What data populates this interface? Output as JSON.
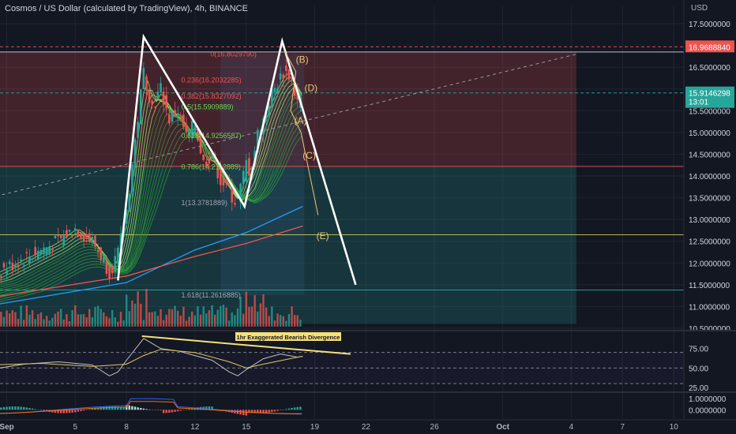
{
  "header": {
    "title": "Cosmos / US Dollar (calculated by TradingView), 4h, BINANCE",
    "currency": "USD"
  },
  "price_tags": {
    "top": "16.9688840",
    "current": "15.9146298",
    "countdown": "13:01"
  },
  "colors": {
    "background": "#131722",
    "grid": "#1f2433",
    "up": "#26a69a",
    "down": "#ef5350",
    "pattern": "#ffffff",
    "wave_labels": "#f0c674",
    "divergence": "#f5e07a",
    "fib_green": "#6bd84f",
    "fib_red": "#ef5350"
  },
  "chart_data": [
    {
      "type": "candlestick",
      "pane": "price",
      "x_axis": {
        "tick_labels": [
          "Sep",
          "5",
          "8",
          "12",
          "15",
          "19",
          "22",
          "26",
          "Oct",
          "4",
          "7",
          "10"
        ],
        "tick_days": [
          1,
          5,
          8,
          12,
          15,
          19,
          22,
          26,
          30,
          34,
          37,
          40
        ]
      },
      "y_axis": {
        "range": [
          10.5,
          17.9
        ],
        "tick_labels": [
          "17.5000000",
          "16.5000000",
          "16.0000000",
          "15.5000000",
          "15.0000000",
          "14.5000000",
          "14.0000000",
          "13.5000000",
          "13.0000000",
          "12.5000000",
          "12.0000000",
          "11.5000000",
          "11.0000000",
          "10.5000000"
        ],
        "tick_values": [
          17.5,
          16.5,
          16.0,
          15.5,
          15.0,
          14.5,
          14.0,
          13.5,
          13.0,
          12.5,
          12.0,
          11.5,
          11.0,
          10.5
        ]
      },
      "price_path": {
        "days": [
          0,
          1,
          2,
          3,
          4,
          5,
          6,
          6.6,
          7,
          7.5,
          8,
          8.5,
          9,
          9.5,
          10,
          10.5,
          11,
          11.5,
          12,
          12.5,
          13,
          13.5,
          14,
          14.3,
          14.6,
          15,
          15.3,
          15.6,
          16,
          16.4,
          16.8,
          17.2,
          17.6,
          17.9,
          18.1,
          18.3
        ],
        "closes": [
          11.7,
          11.9,
          12.1,
          12.3,
          12.5,
          12.8,
          12.5,
          12.1,
          11.8,
          12.2,
          13.2,
          14.8,
          16.4,
          15.6,
          16.0,
          15.3,
          15.5,
          14.9,
          15.2,
          14.3,
          14.5,
          13.9,
          13.7,
          13.4,
          13.6,
          14.3,
          14.0,
          14.9,
          15.3,
          15.8,
          16.1,
          16.4,
          16.3,
          15.8,
          15.6,
          15.9
        ]
      },
      "moving_averages": [
        {
          "color": "#2196f3",
          "points": [
            [
              0,
              11.02
            ],
            [
              8,
              11.55
            ],
            [
              12,
              12.3
            ],
            [
              15,
              12.7
            ],
            [
              18.3,
              13.3
            ]
          ]
        },
        {
          "color": "#ef5350",
          "points": [
            [
              0,
              11.2
            ],
            [
              8,
              11.7
            ],
            [
              12,
              12.15
            ],
            [
              15,
              12.45
            ],
            [
              18.3,
              12.85
            ]
          ]
        }
      ],
      "fibonacci": {
        "levels": [
          {
            "label": "0(16.8029790)",
            "value": 16.8
          },
          {
            "label": "0.236(16.2032285)",
            "value": 16.2
          },
          {
            "label": "0.382(15.8327092)",
            "value": 15.83
          },
          {
            "label": "0.5(15.5909889)",
            "value": 15.59
          },
          {
            "label": "0.618(14.9256587)",
            "value": 14.93
          },
          {
            "label": "0.786(14.2112889)",
            "value": 14.21
          },
          {
            "label": "1(13.3781889)",
            "value": 13.38
          },
          {
            "label": "1.618(11.2616885)",
            "value": 11.26
          }
        ]
      },
      "zones": [
        {
          "top": 16.85,
          "bottom": 14.22,
          "color": "#ef5350"
        },
        {
          "top": 14.22,
          "bottom": 10.6,
          "color": "#26a69a"
        }
      ],
      "horizontal_lines": [
        {
          "value": 16.97,
          "color": "#ef5350",
          "dashed": true
        },
        {
          "value": 16.85,
          "color": "#d1d4dc",
          "dashed": false
        },
        {
          "value": 15.91,
          "color": "#26a69a",
          "dashed": true
        },
        {
          "value": 14.22,
          "color": "#ef5350",
          "dashed": false
        },
        {
          "value": 12.65,
          "color": "#c8c85a",
          "dashed": false
        },
        {
          "value": 11.38,
          "color": "#26a69a",
          "dashed": false
        }
      ],
      "pattern": {
        "points": [
          [
            7.5,
            11.6
          ],
          [
            9.0,
            17.2
          ],
          [
            14.9,
            13.3
          ],
          [
            17.1,
            17.1
          ],
          [
            21.4,
            11.5
          ]
        ]
      },
      "trendline": {
        "points": [
          [
            0,
            13.5
          ],
          [
            34.3,
            16.8
          ]
        ]
      },
      "wave_labels": [
        {
          "text": "(B)",
          "day": 17.9,
          "value": 16.6
        },
        {
          "text": "(D)",
          "day": 18.4,
          "value": 15.95
        },
        {
          "text": "(A)",
          "day": 17.8,
          "value": 15.2
        },
        {
          "text": "(C)",
          "day": 18.3,
          "value": 14.4
        },
        {
          "text": "(E)",
          "day": 19.1,
          "value": 12.55
        }
      ]
    },
    {
      "type": "line",
      "pane": "rsi",
      "y_axis": {
        "range": [
          20,
          95
        ],
        "tick_labels": [
          "75.00",
          "50.00",
          "25.00"
        ],
        "tick_values": [
          75,
          50,
          25
        ]
      },
      "series": [
        {
          "color": "#c0c0c0",
          "days": [
            0,
            2,
            4,
            6,
            7,
            7.5,
            8,
            9,
            10,
            11,
            12,
            13,
            14,
            14.5,
            15,
            16,
            17,
            18,
            18.3
          ],
          "values": [
            48,
            55,
            58,
            54,
            40,
            45,
            60,
            88,
            75,
            72,
            66,
            60,
            45,
            40,
            48,
            62,
            68,
            64,
            65
          ]
        },
        {
          "color": "#e0c85a",
          "days": [
            0,
            3,
            6,
            8,
            9,
            10,
            12,
            14,
            15,
            16,
            18,
            18.3
          ],
          "values": [
            54,
            56,
            52,
            55,
            66,
            74,
            70,
            58,
            50,
            55,
            64,
            65
          ]
        }
      ],
      "divergence_line": {
        "points": [
          [
            8.9,
            91
          ],
          [
            21.1,
            68
          ]
        ]
      },
      "annotation": "1hr Exaggerated Bearish Divergence"
    },
    {
      "type": "bar",
      "pane": "macd",
      "y_axis": {
        "range": [
          -0.3,
          0.6
        ],
        "tick_labels": [
          "1.0000000",
          "0.0000000"
        ],
        "tick_values": [
          0.41,
          0.0
        ]
      }
    }
  ]
}
